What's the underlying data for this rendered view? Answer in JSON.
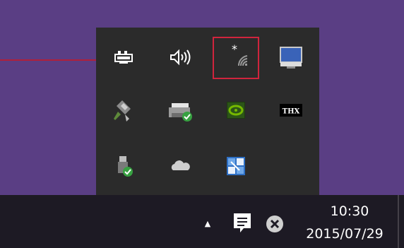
{
  "tray_flyout": {
    "icons": [
      {
        "name": "power-battery-icon",
        "tooltip": ""
      },
      {
        "name": "volume-icon",
        "tooltip": ""
      },
      {
        "name": "wifi-unavailable-icon",
        "tooltip": ""
      },
      {
        "name": "display-icon",
        "tooltip": ""
      },
      {
        "name": "usb-device-icon",
        "tooltip": ""
      },
      {
        "name": "printer-ok-icon",
        "tooltip": ""
      },
      {
        "name": "nvidia-icon",
        "tooltip": ""
      },
      {
        "name": "thx-icon",
        "tooltip": ""
      },
      {
        "name": "usb-safe-remove-icon",
        "tooltip": ""
      },
      {
        "name": "onedrive-icon",
        "tooltip": ""
      },
      {
        "name": "language-ime-icon",
        "tooltip": ""
      }
    ],
    "thx_label": "THX"
  },
  "taskbar": {
    "show_hidden_icons": "▲",
    "clock": {
      "time": "10:30",
      "date": "2015/07/29"
    }
  },
  "colors": {
    "desktop": "#5a3e84",
    "flyout": "#2b2b2b",
    "taskbar": "#1d1a24",
    "highlight": "#d0243d",
    "callout_line": "#b01f3a"
  }
}
